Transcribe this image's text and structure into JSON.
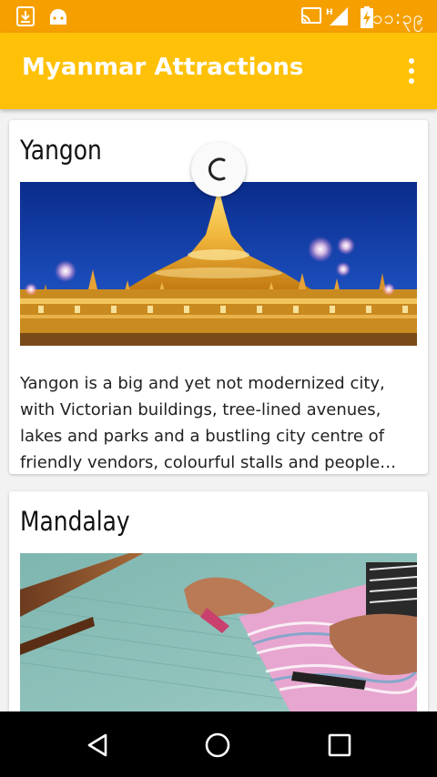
{
  "status_bar": {
    "time": "၁၁:၃၉",
    "icons": [
      "download-icon",
      "android-icon",
      "cast-icon",
      "signal-h-icon",
      "battery-charging-icon"
    ],
    "color": "#F5A000"
  },
  "app_bar": {
    "title": "Myanmar Attractions",
    "color": "#FFC107",
    "menu_icon": "overflow-menu-icon"
  },
  "cards": [
    {
      "title": "Yangon",
      "description": "Yangon is a big and yet not modernized city, with Victorian buildings, tree-lined avenues, lakes and parks and a bustling city centre of friendly vendors, colourful stalls and people…"
    },
    {
      "title": "Mandalay",
      "description": ""
    }
  ],
  "loading": true,
  "nav_bar": {
    "buttons": [
      "back-icon",
      "home-icon",
      "recents-icon"
    ]
  }
}
